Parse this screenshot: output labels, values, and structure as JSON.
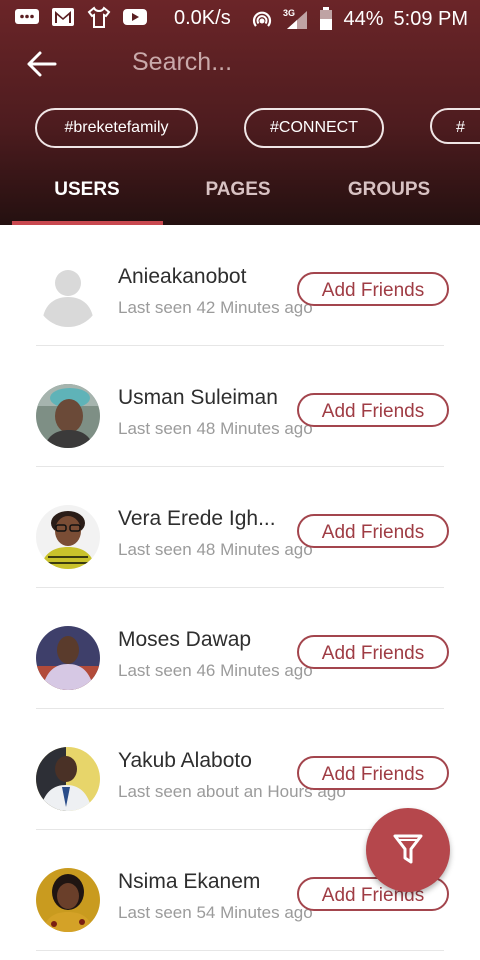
{
  "status_bar": {
    "speed": "0.0K/s",
    "network": "3G",
    "battery": "44%",
    "time": "5:09 PM"
  },
  "search": {
    "placeholder": "Search..."
  },
  "hashtags": [
    "#breketefamily",
    "#CONNECT",
    "#"
  ],
  "tabs": {
    "users": "USERS",
    "pages": "PAGES",
    "groups": "GROUPS",
    "active": "USERS"
  },
  "colors": {
    "header": "#5a1f22",
    "accent": "#a3454d",
    "fab": "#b5474c"
  },
  "users": [
    {
      "name": "Anieakanobot",
      "last_seen": "Last seen 42 Minutes ago",
      "action": "Add Friends",
      "avatar": "placeholder"
    },
    {
      "name": "Usman Suleiman",
      "last_seen": "Last seen 48 Minutes ago",
      "action": "Add Friends",
      "avatar": "photo"
    },
    {
      "name": "Vera Erede Igh...",
      "last_seen": "Last seen 48 Minutes ago",
      "action": "Add Friends",
      "avatar": "photo"
    },
    {
      "name": "Moses Dawap",
      "last_seen": "Last seen 46 Minutes ago",
      "action": "Add Friends",
      "avatar": "photo"
    },
    {
      "name": "Yakub Alaboto",
      "last_seen": "Last seen about an Hours ago",
      "action": "Add Friends",
      "avatar": "photo"
    },
    {
      "name": "Nsima Ekanem",
      "last_seen": "Last seen 54 Minutes ago",
      "action": "Add Friends",
      "avatar": "photo"
    }
  ],
  "fab": {
    "icon": "filter-icon"
  }
}
